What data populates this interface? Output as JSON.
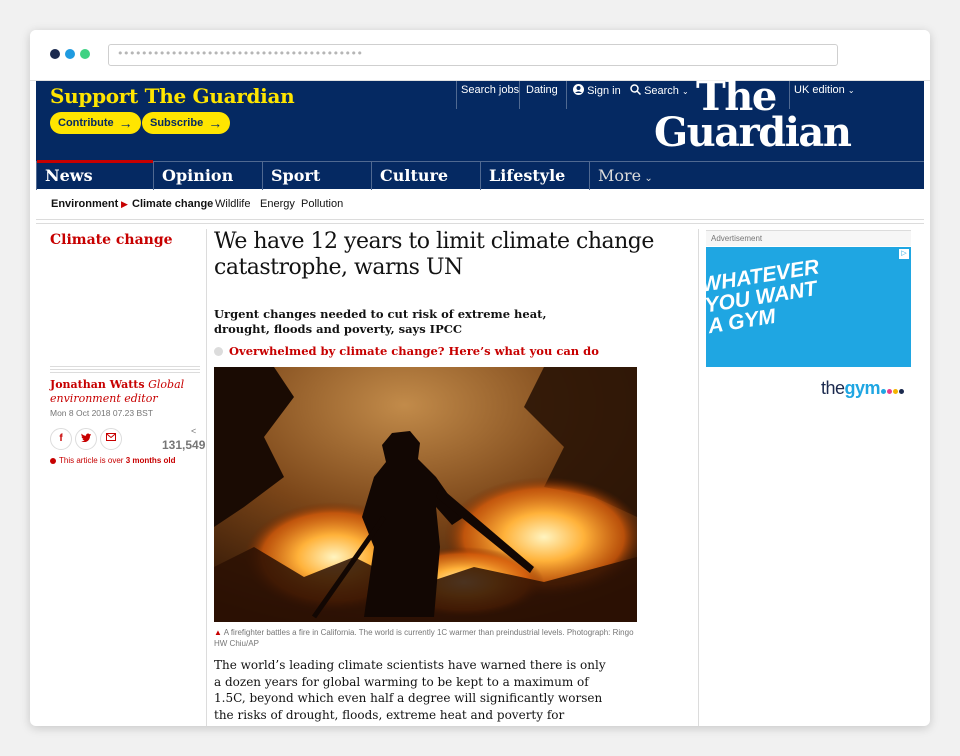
{
  "browser": {
    "url": "•••••••••••••••••••••••••••••••••••••••••"
  },
  "header": {
    "support_title": "Support The Guardian",
    "contribute_label": "Contribute",
    "subscribe_label": "Subscribe",
    "search_jobs": "Search jobs",
    "dating": "Dating",
    "sign_in": "Sign in",
    "search": "Search",
    "edition": "UK edition",
    "logo_line1": "The",
    "logo_line2": "Guardian",
    "brand_color": "#052962",
    "accent_color": "#ffe500"
  },
  "nav": {
    "items": [
      {
        "label": "News"
      },
      {
        "label": "Opinion"
      },
      {
        "label": "Sport"
      },
      {
        "label": "Culture"
      },
      {
        "label": "Lifestyle"
      },
      {
        "label": "More"
      }
    ]
  },
  "subnav": {
    "items": [
      "Environment",
      "Climate change",
      "Wildlife",
      "Energy",
      "Pollution"
    ]
  },
  "article": {
    "section": "Climate change",
    "headline": "We have 12 years to limit climate change catastrophe, warns UN",
    "standfirst": "Urgent changes needed to cut risk of extreme heat, drought, floods and poverty, says IPCC",
    "related_link": "Overwhelmed by climate change? Here’s what you can do",
    "author": "Jonathan Watts",
    "author_role": "Global environment editor",
    "date": "Mon 8 Oct 2018 07.23 BST",
    "share_count": "131,549",
    "age_warning_prefix": "This article is over",
    "age_warning_value": "3 months old",
    "caption": "A firefighter battles a fire in California. The world is currently 1C warmer than preindustrial levels. Photograph: Ringo HW Chiu/AP",
    "body": "The world’s leading climate scientists have warned there is only a dozen years for global warming to be kept to a maximum of 1.5C, beyond which even half a degree will significantly worsen the risks of drought, floods, extreme heat and poverty for hundreds of millions of people."
  },
  "advert": {
    "label": "Advertisement",
    "line1": "WHATEVER",
    "line2": "YOU WANT",
    "line3": "A GYM",
    "brand_pre": "the",
    "brand_main": "gym"
  }
}
